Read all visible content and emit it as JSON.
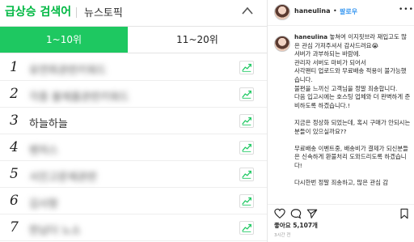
{
  "rankings": {
    "title": "급상승 검색어",
    "news_tab": "뉴스토픽",
    "tabs": [
      "1~10위",
      "11~20위"
    ],
    "items": [
      {
        "rank": "1",
        "keyword": "유연희관련키워드",
        "blurred": true
      },
      {
        "rank": "2",
        "keyword": "각종 볼제품관련키워드",
        "blurred": true
      },
      {
        "rank": "3",
        "keyword": "하늘하늘",
        "blurred": false
      },
      {
        "rank": "4",
        "keyword": "벤처스",
        "blurred": true
      },
      {
        "rank": "5",
        "keyword": "서진고문제관련",
        "blurred": true
      },
      {
        "rank": "6",
        "keyword": "김사항",
        "blurred": true
      },
      {
        "rank": "7",
        "keyword": "한남더 노소",
        "blurred": true
      }
    ]
  },
  "instagram": {
    "username": "haneulina",
    "separator": "•",
    "follow_label": "팔로우",
    "more_label": "•••",
    "caption_user": "haneulina",
    "caption_text": " 놓쳐여 이지핏브라 재입고도 많은 관심 가져주셔서 감사드려요😭\n서버가 과부하되는 바람에.\n관리자 서버도 마비가 되어서\n사각팬티 업로드와 무료배송 적용이 불가능했습니다.\n불편을 느끼신 고객님을 정말 죄송합니다.\n다음 입고시에는 호스팅 업체와 더 완벽하게 준비하도록 하겠습니다.!\n\n지금은 정상화 되었는데, 혹시 구매가 안되시는 분들이 있으실까요??\n\n무료배송 이벤트중, 배송비가 결제가 되신분들은 신속하게 환불처리 도와드리도록 하겠습니다!\n\n다시한번 정말 죄송하고, 많은 관심 감",
    "likes": "좋아요 5,107개",
    "posted_ago": "3시간 전"
  },
  "colors": {
    "accent_green": "#1ec861",
    "title_green": "#00b843",
    "follow_blue": "#3897f0"
  }
}
